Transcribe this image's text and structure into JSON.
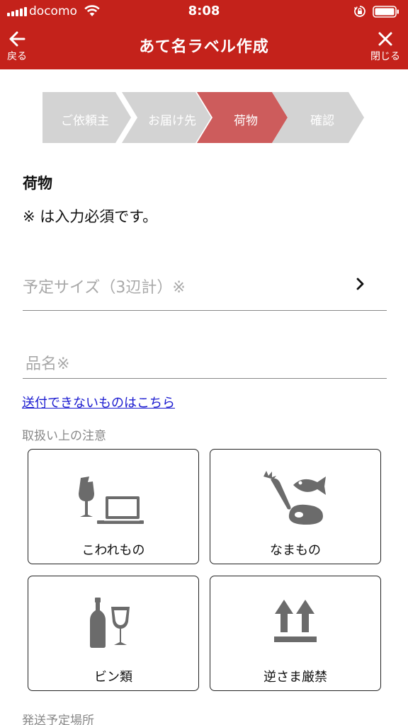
{
  "status_bar": {
    "carrier": "docomo",
    "time": "8:08"
  },
  "nav": {
    "back_label": "戻る",
    "title": "あて名ラベル作成",
    "close_label": "閉じる"
  },
  "stepper": {
    "steps": [
      "ご依頼主",
      "お届け先",
      "荷物",
      "確認"
    ],
    "active_index": 2
  },
  "form": {
    "section_title": "荷物",
    "required_note": "※ は入力必須です。",
    "size_placeholder": "予定サイズ（3辺計）※",
    "item_name_placeholder": "品名※",
    "prohibited_link": "送付できないものはこちら",
    "handling_caption": "取扱い上の注意",
    "handling_options": [
      {
        "label": "こわれもの",
        "icon": "fragile-icon"
      },
      {
        "label": "なまもの",
        "icon": "perishable-icon"
      },
      {
        "label": "ビン類",
        "icon": "bottles-icon"
      },
      {
        "label": "逆さま厳禁",
        "icon": "this-side-up-icon"
      }
    ],
    "shipping_location_caption": "発送予定場所"
  },
  "colors": {
    "brand_red": "#c4221b",
    "step_active": "#cd5c5c",
    "step_inactive": "#d3d3d3",
    "icon_gray": "#6b6b6b"
  }
}
